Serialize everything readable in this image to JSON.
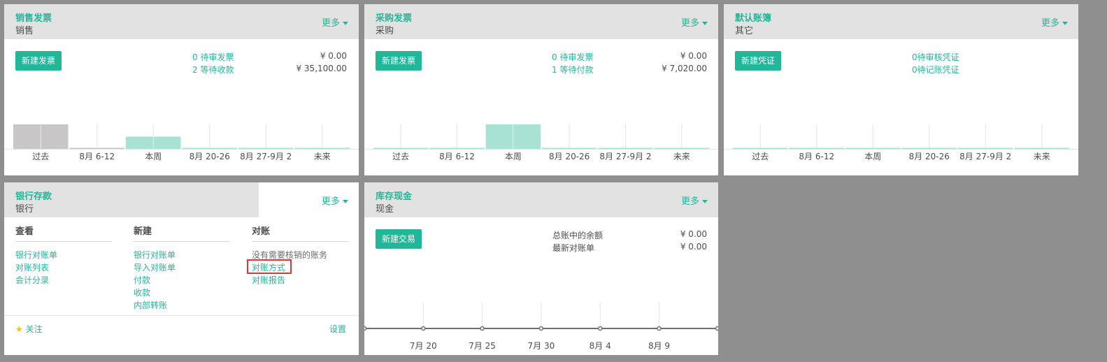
{
  "more_label": "更多",
  "sales": {
    "title": "销售发票",
    "subtitle": "销售",
    "new_button": "新建发票",
    "pending_link": "0 待审发票",
    "pending_amount": "¥ 0.00",
    "waiting_link": "2 等待收款",
    "waiting_amount": "¥ 35,100.00",
    "bars": [
      1,
      0,
      0.5,
      0,
      0,
      0
    ],
    "bar_colors": [
      "#c8c6c6",
      "#c8c6c6",
      "#a8e2d4",
      "#a8e2d4",
      "#a8e2d4",
      "#a8e2d4"
    ]
  },
  "purchase": {
    "title": "采购发票",
    "subtitle": "采购",
    "new_button": "新建发票",
    "pending_link": "0 待审发票",
    "pending_amount": "¥ 0.00",
    "waiting_link": "1 等待付款",
    "waiting_amount": "¥ 7,020.00",
    "bars": [
      0,
      0,
      1,
      0,
      0,
      0
    ],
    "bar_colors": [
      "#a8e2d4",
      "#a8e2d4",
      "#a8e2d4",
      "#a8e2d4",
      "#a8e2d4",
      "#a8e2d4"
    ]
  },
  "misc": {
    "title": "默认账簿",
    "subtitle": "其它",
    "new_button": "新建凭证",
    "pending_link": "0待审核凭证",
    "posting_link": "0待记账凭证",
    "bars": [
      0,
      0,
      0,
      0,
      0,
      0
    ],
    "bar_colors": [
      "#a8e2d4",
      "#a8e2d4",
      "#a8e2d4",
      "#a8e2d4",
      "#a8e2d4",
      "#a8e2d4"
    ]
  },
  "week_labels": [
    "过去",
    "8月 6-12",
    "本周",
    "8月 20-26",
    "8月 27-9月 2",
    "未来"
  ],
  "bank": {
    "title": "银行存款",
    "subtitle": "银行",
    "view_head": "查看",
    "view_items": [
      "银行对账单",
      "对账列表",
      "会计分录"
    ],
    "new_head": "新建",
    "new_items": [
      "银行对账单",
      "导入对账单",
      "付款",
      "收款",
      "内部转账"
    ],
    "reconcile_head": "对账",
    "reconcile_note": "没有需要核销的账务",
    "reconcile_items": [
      "对账方式",
      "对账报告"
    ],
    "follow_label": "关注",
    "settings_label": "设置"
  },
  "cash": {
    "title": "库存现金",
    "subtitle": "现金",
    "new_button": "新建交易",
    "ledger_label": "总账中的余额",
    "ledger_amount": "¥ 0.00",
    "statement_label": "最新对账单",
    "statement_amount": "¥ 0.00",
    "dates": [
      "7月 20",
      "7月 25",
      "7月 30",
      "8月 4",
      "8月 9"
    ],
    "values": [
      0,
      0,
      0,
      0,
      0,
      0,
      0
    ]
  }
}
